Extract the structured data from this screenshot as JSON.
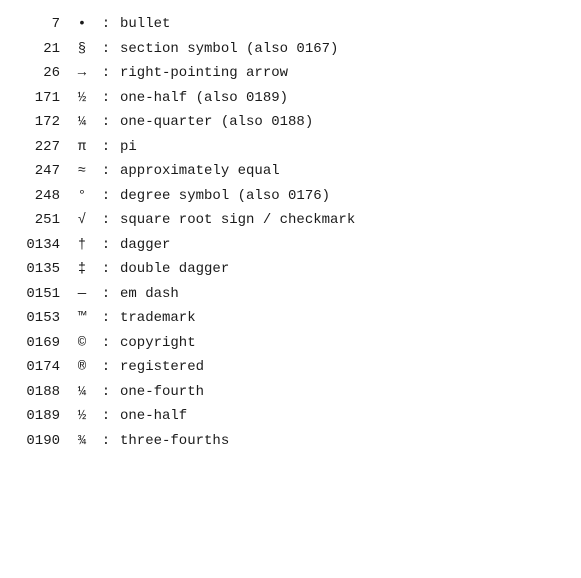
{
  "rows": [
    {
      "code": "7",
      "symbol": "•",
      "desc": "bullet"
    },
    {
      "code": "21",
      "symbol": "§",
      "desc": "section symbol (also 0167)"
    },
    {
      "code": "26",
      "symbol": "→",
      "desc": "right-pointing arrow"
    },
    {
      "code": "171",
      "symbol": "½",
      "desc": "one-half (also 0189)"
    },
    {
      "code": "172",
      "symbol": "¼",
      "desc": "one-quarter (also 0188)"
    },
    {
      "code": "227",
      "symbol": "π",
      "desc": "pi"
    },
    {
      "code": "247",
      "symbol": "≈",
      "desc": "approximately equal"
    },
    {
      "code": "248",
      "symbol": "°",
      "desc": "degree symbol (also 0176)"
    },
    {
      "code": "251",
      "symbol": "√",
      "desc": "square root sign / checkmark"
    },
    {
      "code": "0134",
      "symbol": "†",
      "desc": "dagger"
    },
    {
      "code": "0135",
      "symbol": "‡",
      "desc": "double dagger"
    },
    {
      "code": "0151",
      "symbol": "—",
      "desc": "em dash"
    },
    {
      "code": "0153",
      "symbol": "™",
      "desc": "trademark"
    },
    {
      "code": "0169",
      "symbol": "©",
      "desc": "copyright"
    },
    {
      "code": "0174",
      "symbol": "®",
      "desc": "registered"
    },
    {
      "code": "0188",
      "symbol": "¼",
      "desc": "one-fourth"
    },
    {
      "code": "0189",
      "symbol": "½",
      "desc": "one-half"
    },
    {
      "code": "0190",
      "symbol": "¾",
      "desc": "three-fourths"
    }
  ],
  "separator": ":"
}
